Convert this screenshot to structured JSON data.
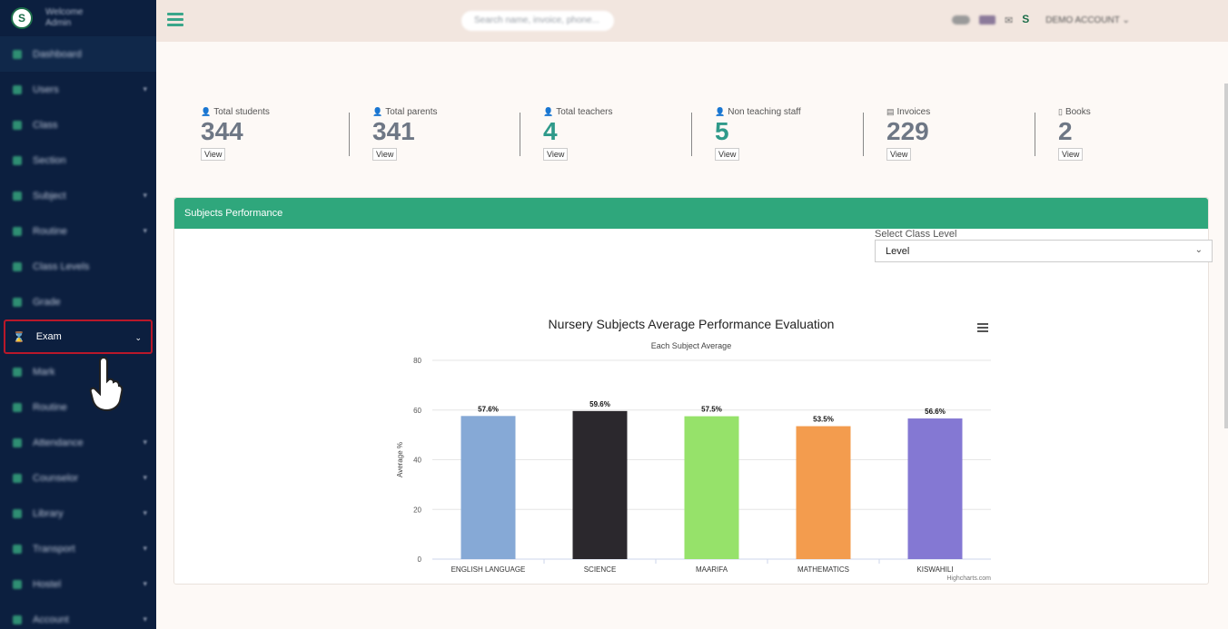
{
  "sidebar": {
    "welcome": "Welcome",
    "user": "Admin",
    "items": [
      {
        "label": "Dashboard",
        "chev": ""
      },
      {
        "label": "Users",
        "chev": "▾"
      },
      {
        "label": "Class",
        "chev": ""
      },
      {
        "label": "Section",
        "chev": ""
      },
      {
        "label": "Subject",
        "chev": "▾"
      },
      {
        "label": "Routine",
        "chev": "▾"
      },
      {
        "label": "Class Levels",
        "chev": ""
      },
      {
        "label": "Grade",
        "chev": ""
      },
      {
        "label": "Exam",
        "chev": "⌄"
      },
      {
        "label": "Mark",
        "chev": ""
      },
      {
        "label": "Routine",
        "chev": ""
      },
      {
        "label": "Attendance",
        "chev": "▾"
      },
      {
        "label": "Counselor",
        "chev": "▾"
      },
      {
        "label": "Library",
        "chev": "▾"
      },
      {
        "label": "Transport",
        "chev": "▾"
      },
      {
        "label": "Hostel",
        "chev": "▾"
      },
      {
        "label": "Account",
        "chev": "▾"
      }
    ]
  },
  "topbar": {
    "search_placeholder": "Search name, invoice, phone...",
    "account": "DEMO ACCOUNT ⌄",
    "mail_icon": "✉"
  },
  "stats": [
    {
      "label": "Total students",
      "value": "344",
      "view": "View",
      "icon": "user-icon",
      "glyph": "👤"
    },
    {
      "label": "Total parents",
      "value": "341",
      "view": "View",
      "icon": "user-icon",
      "glyph": "👤"
    },
    {
      "label": "Total teachers",
      "value": "4",
      "view": "View",
      "icon": "user-icon",
      "glyph": "👤"
    },
    {
      "label": "Non teaching staff",
      "value": "5",
      "view": "View",
      "icon": "user-icon",
      "glyph": "👤"
    },
    {
      "label": "Invoices",
      "value": "229",
      "view": "View",
      "icon": "file-icon",
      "glyph": "▤"
    },
    {
      "label": "Books",
      "value": "2",
      "view": "View",
      "icon": "file-outline-icon",
      "glyph": "▯"
    }
  ],
  "panel": {
    "title": "Subjects Performance",
    "select_label": "Select Class Level",
    "select_value": "Level",
    "select_chevron": "⌄"
  },
  "colors": {
    "accent": "#2fa77c",
    "sidebar": "#0c1f3f",
    "highlight_border": "#b9182a"
  },
  "chart_data": {
    "type": "bar",
    "title": "Nursery Subjects Average Performance Evaluation",
    "subtitle": "Each Subject Average",
    "ylabel": "Average %",
    "xlabel": "",
    "ylim": [
      0,
      80
    ],
    "yticks": [
      0,
      20,
      40,
      60,
      80
    ],
    "categories": [
      "ENGLISH LANGUAGE",
      "SCIENCE",
      "MAARIFA",
      "MATHEMATICS",
      "KISWAHILI"
    ],
    "values": [
      57.6,
      59.6,
      57.5,
      53.5,
      56.6
    ],
    "data_labels": [
      "57.6%",
      "59.6%",
      "57.5%",
      "53.5%",
      "56.6%"
    ],
    "bar_colors": [
      "#86a9d6",
      "#2b282d",
      "#96e26a",
      "#f39c4e",
      "#8478d3"
    ],
    "credit": "Highcharts.com",
    "grid": true,
    "legend": "none"
  }
}
